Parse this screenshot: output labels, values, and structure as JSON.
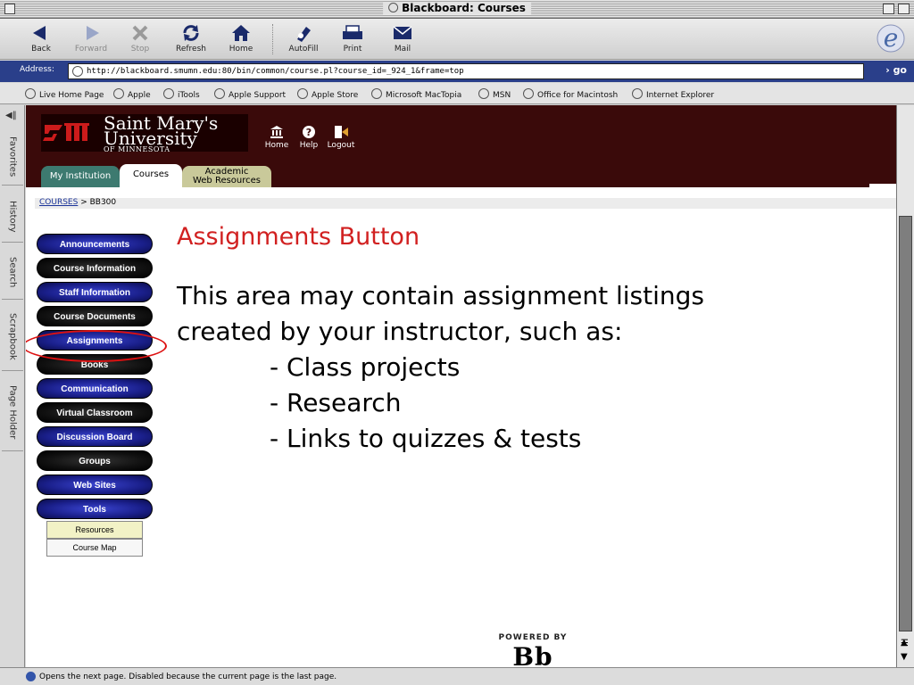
{
  "window": {
    "title": "Blackboard: Courses"
  },
  "toolbar": {
    "back": "Back",
    "forward": "Forward",
    "stop": "Stop",
    "refresh": "Refresh",
    "home": "Home",
    "autofill": "AutoFill",
    "print": "Print",
    "mail": "Mail"
  },
  "address": {
    "label": "Address:",
    "url": "http://blackboard.smumn.edu:80/bin/common/course.pl?course_id=_924_1&frame=top",
    "go": "go"
  },
  "favorites": [
    "Live Home Page",
    "Apple",
    "iTools",
    "Apple Support",
    "Apple Store",
    "Microsoft MacTopia",
    "MSN",
    "Office for Macintosh",
    "Internet Explorer"
  ],
  "side_tabs": [
    "Favorites",
    "History",
    "Search",
    "Scrapbook",
    "Page Holder"
  ],
  "header": {
    "logo_line1": "Saint Mary's",
    "logo_line2": "University",
    "logo_line3": "OF MINNESOTA",
    "home": "Home",
    "help": "Help",
    "logout": "Logout"
  },
  "tabs": {
    "my_institution": "My Institution",
    "courses": "Courses",
    "academic_line1": "Academic",
    "academic_line2": "Web Resources"
  },
  "breadcrumb": {
    "root": "COURSES",
    "sep": " > ",
    "current": "BB300"
  },
  "menu": {
    "buttons": [
      "Announcements",
      "Course Information",
      "Staff Information",
      "Course Documents",
      "Assignments",
      "Books",
      "Communication",
      "Virtual Classroom",
      "Discussion Board",
      "Groups",
      "Web Sites",
      "Tools"
    ],
    "resources": "Resources",
    "course_map": "Course Map"
  },
  "main": {
    "headline": "Assignments Button",
    "para_line1": "This area may contain assignment listings",
    "para_line2": "created by your instructor, such as:",
    "items": [
      "- Class projects",
      "- Research",
      "- Links to quizzes & tests"
    ]
  },
  "powered": {
    "label": "POWERED BY",
    "brand": "Bb"
  },
  "status": {
    "text": "Opens the next page. Disabled because the current page is the last page."
  },
  "colors": {
    "header_band": "#3a0a0a",
    "highlight_ring": "#d11111",
    "headline": "#d12020",
    "address_bar": "#2a3f8a"
  }
}
